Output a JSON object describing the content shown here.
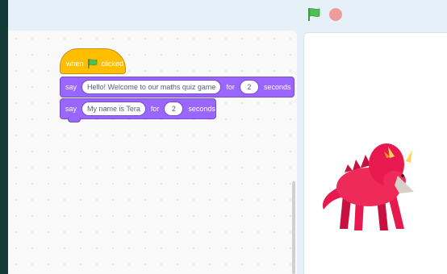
{
  "controls": {
    "green_flag_icon": "green-flag-icon",
    "stop_icon": "stop-icon"
  },
  "script": {
    "hat": {
      "prefix": "when",
      "suffix": "clicked"
    },
    "blocks": [
      {
        "keyword": "say",
        "message": "Hello! Welcome to our maths quiz game",
        "for_label": "for",
        "seconds_value": "2",
        "seconds_label": "seconds"
      },
      {
        "keyword": "say",
        "message": "My name is Tera",
        "for_label": "for",
        "seconds_value": "2",
        "seconds_label": "seconds"
      }
    ]
  },
  "colors": {
    "events": "#ffbf00",
    "looks": "#9966ff",
    "stop": "#ec9c9d",
    "flag": "#4cbf56"
  }
}
